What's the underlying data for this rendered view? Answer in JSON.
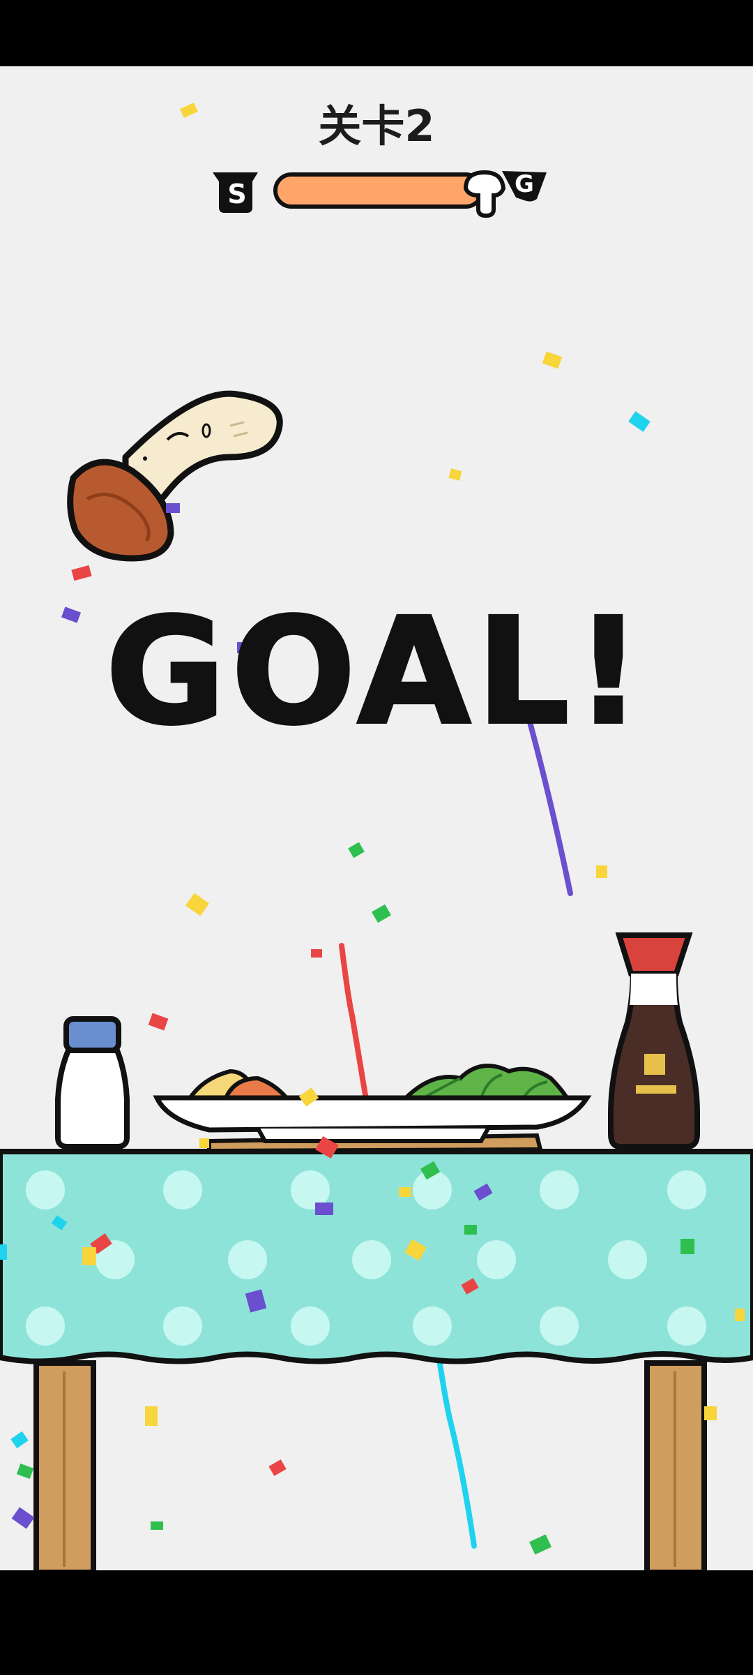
{
  "level": {
    "title": "关卡2"
  },
  "progress": {
    "start_label": "S",
    "goal_label": "G",
    "fraction": 1.0,
    "fill_color": "#ffa56a"
  },
  "result": {
    "text": "GOAL!"
  },
  "colors": {
    "background": "#f0f0f0",
    "tablecloth": "#8ee3d9",
    "tablecloth_dots": "#c7f7f1",
    "table_legs": "#cf9d5d",
    "soy_bottle": "#4a2d26",
    "soy_cap": "#d8443d",
    "salt_cap": "#6a8fd1",
    "mushroom_cap": "#b85a2f",
    "mushroom_stem": "#f6ebcf"
  },
  "icons": [
    "start-flag-icon",
    "goal-flag-icon",
    "mushroom-marker-icon",
    "mushroom-character",
    "salt-shaker",
    "soy-sauce-bottle",
    "plate-of-food",
    "chopsticks",
    "confetti"
  ]
}
